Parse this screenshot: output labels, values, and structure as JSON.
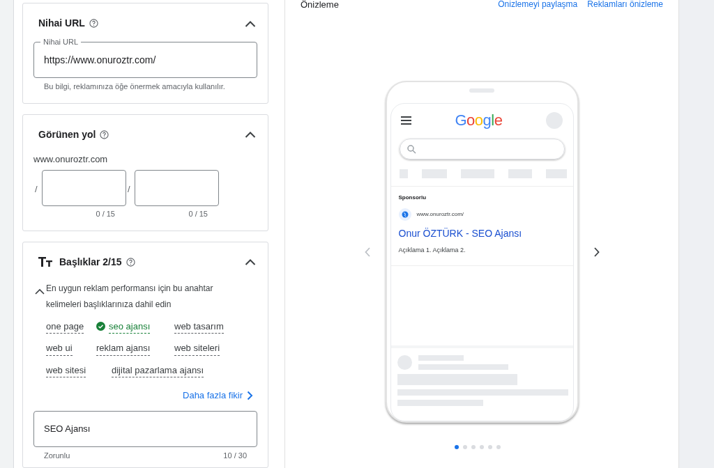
{
  "sections": [
    {
      "kind": "url",
      "title": "Nihai URL",
      "expanded": true,
      "field": {
        "label": "Nihai URL",
        "value": "https://www.onuroztr.com/"
      },
      "hint": "Bu bilgi, reklamınıza öğe önermek amacıyla kullanılır."
    },
    {
      "kind": "path",
      "title": "Görünen yol",
      "expanded": true,
      "domain": "www.onuroztr.com",
      "separator": "/",
      "paths": [
        {
          "counter": "0 / 15"
        },
        {
          "counter": "0 / 15"
        }
      ]
    },
    {
      "kind": "headlines",
      "title": "Başlıklar 2/15",
      "expanded": true,
      "suggestions_expanded": true,
      "suggestion_text": "En uygun reklam performansı için bu anahtar kelimeleri başlıklarınıza dahil edin",
      "keywords": [
        {
          "text": "one page",
          "used": false
        },
        {
          "text": "seo ajansı",
          "used": true
        },
        {
          "text": "web tasarım",
          "used": false
        },
        {
          "text": "web ui",
          "used": false
        },
        {
          "text": "reklam ajansı",
          "used": false
        },
        {
          "text": "web siteleri",
          "used": false
        },
        {
          "text": "web sitesi",
          "used": false
        },
        {
          "text": "dijital pazarlama ajansı",
          "used": false
        }
      ],
      "more_ideas": "Daha fazla fikir",
      "headline": {
        "value": "SEO Ajansı",
        "helper": "Zorunlu",
        "counter": "10 / 30"
      }
    }
  ],
  "preview": {
    "title": "Önizleme",
    "links": [
      "Önizlemeyi paylaşma",
      "Reklamları önizleme"
    ],
    "logo": "Google",
    "ad": {
      "sponsored": "Sponsorlu",
      "url": "www.onuroztr.com/",
      "headline": "Onur ÖZTÜRK - SEO Ajansı",
      "description": "Açıklama 1. Açıklama 2."
    },
    "dots": [
      {
        "selected": true
      },
      {
        "selected": false
      },
      {
        "selected": false
      },
      {
        "selected": false
      },
      {
        "selected": false
      },
      {
        "selected": false
      }
    ]
  }
}
